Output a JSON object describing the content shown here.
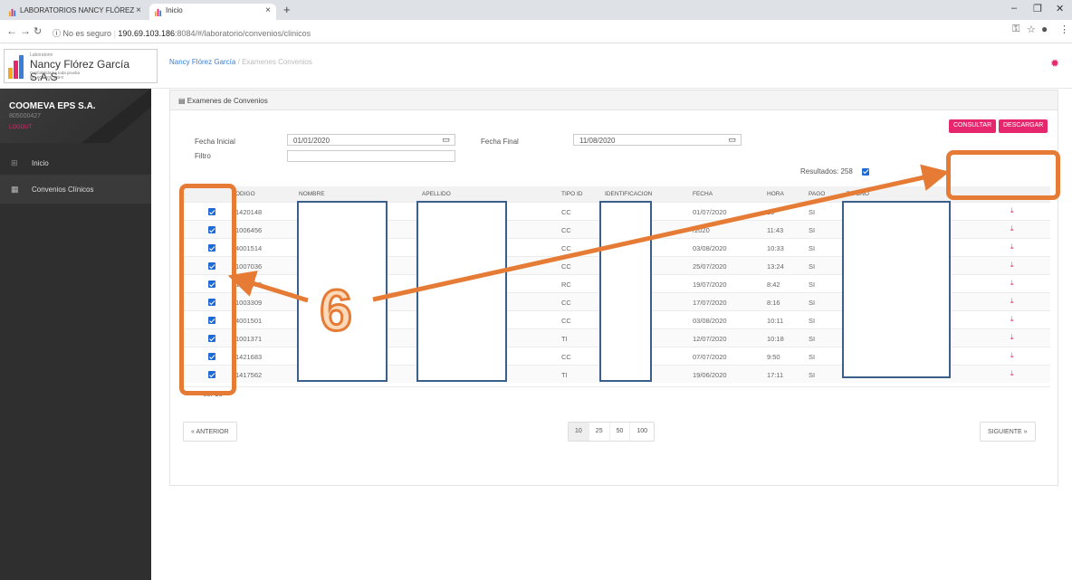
{
  "browser": {
    "tabs": [
      {
        "title": "LABORATORIOS NANCY FLÓREZ"
      },
      {
        "title": "Inicio"
      }
    ],
    "address": {
      "security": "No es seguro",
      "host": "190.69.103.186",
      "path": ":8084/#/laboratorio/convenios/clinicos"
    }
  },
  "logo": {
    "small": "Laboratorio",
    "name": "Nancy Flórez García S.A.S",
    "tagline": "Confiabilidad a toda prueba",
    "nit": "Nit. 804.005.588-0"
  },
  "breadcrumb": {
    "home": "Nancy Flórez García",
    "sep": "/",
    "current": "Examenes Convenios"
  },
  "sidebar": {
    "company": "COOMEVA EPS S.A.",
    "nit": "805000427",
    "logout": "LOGOUT",
    "items": [
      {
        "label": "Inicio",
        "icon": "grid-icon"
      },
      {
        "label": "Convenios Clínicos",
        "icon": "table-icon"
      }
    ]
  },
  "panel": {
    "title": "Examenes de Convenios",
    "consultar": "CONSULTAR",
    "descargar": "DESCARGAR",
    "fecha_inicial_label": "Fecha Inicial",
    "fecha_inicial": "01/01/2020",
    "fecha_final_label": "Fecha Final",
    "fecha_final": "11/08/2020",
    "filtro_label": "Filtro",
    "filtro_value": "",
    "resultados": "Resultados: 258"
  },
  "table": {
    "headers": [
      "ODIGO",
      "NOMBRE",
      "APELLIDO",
      "TIPO ID",
      "IDENTIFICACION",
      "FECHA",
      "HORA",
      "PAGO",
      "TE  ONO"
    ],
    "rows": [
      {
        "codigo": "1420148",
        "tipo": "CC",
        "fecha": "01/07/2020",
        "hora": "10",
        "pago": "SI"
      },
      {
        "codigo": "1006456",
        "tipo": "CC",
        "fecha": "  /2020",
        "hora": "11:43",
        "pago": "SI"
      },
      {
        "codigo": "4001514",
        "tipo": "CC",
        "fecha": "03/08/2020",
        "hora": "10:33",
        "pago": "SI"
      },
      {
        "codigo": "1007036",
        "tipo": "CC",
        "fecha": "25/07/2020",
        "hora": "13:24",
        "pago": "SI"
      },
      {
        "codigo": "1004370",
        "tipo": "RC",
        "fecha": "19/07/2020",
        "hora": "8:42",
        "pago": "SI"
      },
      {
        "codigo": "1003309",
        "tipo": "CC",
        "fecha": "17/07/2020",
        "hora": "8:16",
        "pago": "SI"
      },
      {
        "codigo": "4001501",
        "tipo": "CC",
        "fecha": "03/08/2020",
        "hora": "10:11",
        "pago": "SI"
      },
      {
        "codigo": "1001371",
        "tipo": "TI",
        "fecha": "12/07/2020",
        "hora": "10:18",
        "pago": "SI"
      },
      {
        "codigo": "1421683",
        "tipo": "CC",
        "fecha": "07/07/2020",
        "hora": "9:50",
        "pago": "SI"
      },
      {
        "codigo": "1417562",
        "tipo": "TI",
        "fecha": "19/06/2020",
        "hora": "17:11",
        "pago": "SI"
      }
    ],
    "footer": "os: 10"
  },
  "pagination": {
    "prev": "« ANTERIOR",
    "next": "SIGUIENTE »",
    "sizes": [
      "10",
      "25",
      "50",
      "100"
    ]
  },
  "annotation": {
    "number": "6"
  },
  "colors": {
    "accent": "#e6276e",
    "annotation": "#e57b35",
    "redaction": "#3a5f8a",
    "checkbox": "#1f6bd6"
  }
}
